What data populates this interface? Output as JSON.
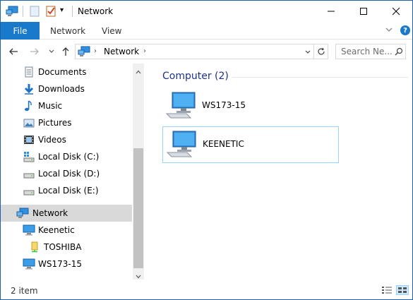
{
  "window": {
    "title": "Network",
    "quick_access_dropdown_glyph": "▾"
  },
  "ribbon": {
    "tabs": [
      {
        "label": "File"
      },
      {
        "label": "Network"
      },
      {
        "label": "View"
      }
    ]
  },
  "address_bar": {
    "path": "Network",
    "separator_glyph": "›"
  },
  "search": {
    "placeholder": "Search Ne..."
  },
  "nav_pane": {
    "items": [
      {
        "label": "Documents",
        "icon": "documents-icon"
      },
      {
        "label": "Downloads",
        "icon": "downloads-icon"
      },
      {
        "label": "Music",
        "icon": "music-icon"
      },
      {
        "label": "Pictures",
        "icon": "pictures-icon"
      },
      {
        "label": "Videos",
        "icon": "videos-icon"
      },
      {
        "label": "Local Disk (C:)",
        "icon": "system-drive-icon"
      },
      {
        "label": "Local Disk (D:)",
        "icon": "drive-icon"
      },
      {
        "label": "Local Disk (E:)",
        "icon": "drive-icon"
      },
      {
        "label": "Network",
        "icon": "network-icon",
        "selected": true
      },
      {
        "label": "Keenetic",
        "icon": "computer-icon"
      },
      {
        "label": "TOSHIBA",
        "icon": "share-folder-icon"
      },
      {
        "label": "WS173-15",
        "icon": "computer-icon"
      }
    ]
  },
  "content": {
    "group_header": "Computer (2)",
    "items": [
      {
        "label": "WS173-15",
        "icon": "computer-icon"
      },
      {
        "label": "KEENETIC",
        "icon": "computer-icon",
        "focused": true
      }
    ]
  },
  "status": {
    "item_count": "2 item"
  },
  "colors": {
    "accent": "#1979ca",
    "group_header": "#1e3287",
    "selection": "#d9d9d9",
    "focus_border": "#99d1ff"
  }
}
